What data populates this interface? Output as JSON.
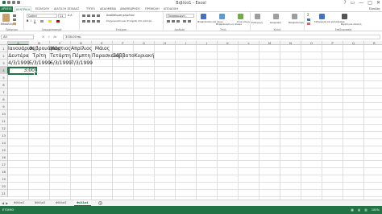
{
  "window": {
    "title": "Βιβλίο1 - Excel",
    "controls": [
      "?",
      "▭",
      "—",
      "□",
      "✕"
    ]
  },
  "ribbon_tabs": [
    "ΑΡΧΕΙΟ",
    "ΚΕΝΤΡΙΚΗ",
    "ΕΙΣΑΓΩΓΗ",
    "ΔΙΑΤΑΞΗ ΣΕΛΙΔΑΣ",
    "ΤΥΠΟΙ",
    "ΔΕΔΟΜΕΝΑ",
    "ΑΝΑΘΕΩΡΗΣΗ",
    "ΠΡΟΒΟΛΗ",
    "ΑΠΟΔΟΧΗ"
  ],
  "account": "Είσοδος",
  "ribbon": {
    "paste_label": "Επικόλληση",
    "clipboard_group": "Πρόχειρο",
    "font_name": "Calibri",
    "font_size": "11",
    "font_group": "Γραμματοσειρά",
    "wrap_text": "Αναδίπλωση κειμένου",
    "merge_center": "Συγχώνευση και στοίχιση στο κέντρο",
    "alignment_group": "Στοίχιση",
    "number_format": "Προσαρμογή",
    "number_group": "Αριθμός",
    "conditional_format": "Μορφοποίηση υπό όρους",
    "format_as_table": "Μορφοποίηση ως πίνακα",
    "cell_styles": "Στυλ κελιών",
    "styles_group": "Στυλ",
    "insert": "Εισαγωγή",
    "delete": "Διαγραφή",
    "format": "Μορφοποίηση",
    "cells_group": "Κελιά",
    "sort_filter": "Ταξινόμηση και φιλτράρισμα",
    "find_select": "Εύρεση και επιλογή",
    "editing_group": "Επεξεργασία"
  },
  "formula_bar": {
    "name_box": "A4",
    "fx_cancel": "✕",
    "fx_enter": "✓",
    "fx_label": "fx",
    "value": "3:00:00 πμ"
  },
  "columns": [
    "A",
    "B",
    "C",
    "D",
    "E",
    "F",
    "G",
    "H",
    "I",
    "J",
    "K",
    "L",
    "M",
    "N",
    "O",
    "P",
    "Q",
    "R"
  ],
  "rows": [
    "1",
    "2",
    "3",
    "4",
    "5",
    "6",
    "7",
    "8",
    "9",
    "10",
    "11",
    "12",
    "13",
    "14",
    "15",
    "16",
    "17",
    "18",
    "19",
    "20",
    "21"
  ],
  "cells": {
    "A1": "Ιανουάριος",
    "B1": "Φεβρουάριος",
    "C1": "Μάρτιος",
    "D1": "Απρίλιος",
    "E1": "Μάιος",
    "A2": "Δευτέρα",
    "B2": "Τρίτη",
    "C2": "Τετάρτη",
    "D2": "Πέμπτη",
    "E2": "Παρασκευή",
    "F2": "Σάββατο",
    "G2": "Κυριακή",
    "A3": "4/3/1999",
    "B3": "5/3/1999",
    "C3": "6/3/1999",
    "D3": "7/3/1999",
    "A4": "3:00"
  },
  "sheets": [
    "Φύλλο1",
    "Φύλλο2",
    "Φύλλο3",
    "Φύλλο4"
  ],
  "active_sheet": "Φύλλο4",
  "status": {
    "ready": "ΕΤΟΙΜΟ",
    "zoom": "100%"
  },
  "colors": {
    "accent": "#217346"
  }
}
